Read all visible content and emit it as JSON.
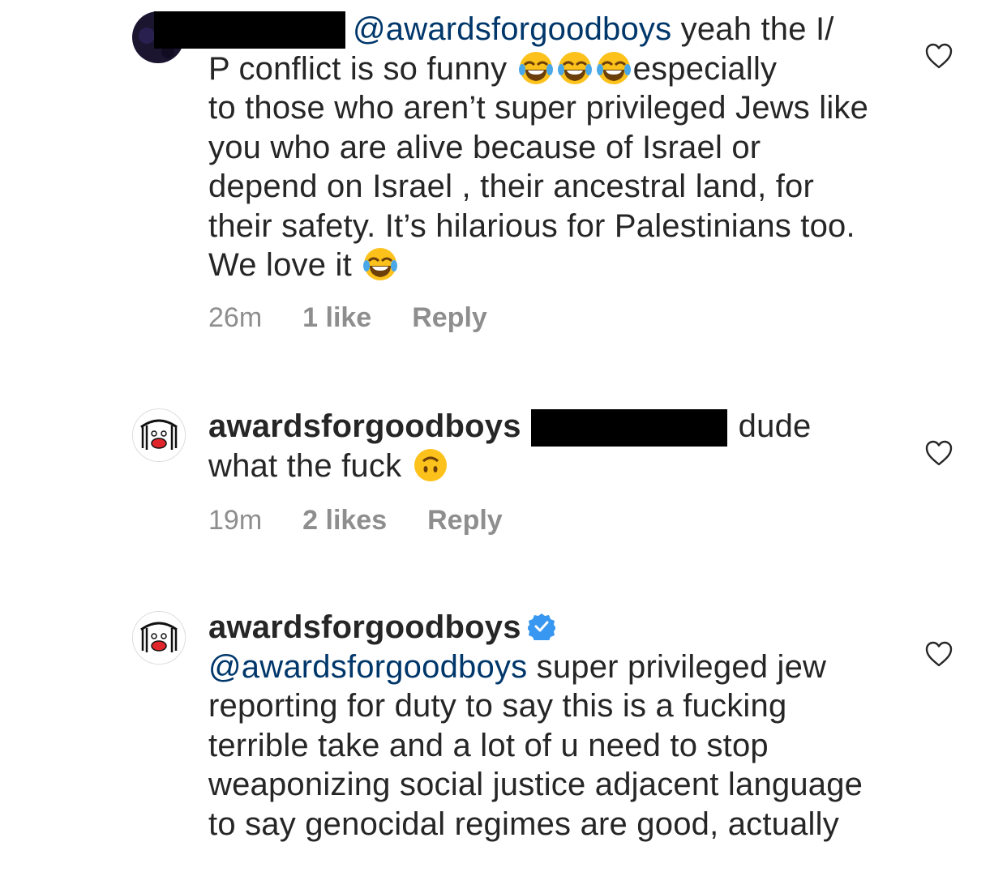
{
  "comments": [
    {
      "mention": "@awardsforgoodboys",
      "text_line1_rest": " yeah the I/",
      "text_line2_a": "P conflict is so funny ",
      "text_line2_b": "especially",
      "text_rest": "to those who aren’t super privileged Jews like you  who are alive because of Israel or depend on Israel , their ancestral land, for their safety. It’s hilarious for Palestinians too. We love it ",
      "time": "26m",
      "likes": "1 like",
      "reply": "Reply",
      "icons": [
        "avatar-redacted",
        "laughing-tears-emoji",
        "heart-outline-icon"
      ]
    },
    {
      "username": "awardsforgoodboys",
      "text_a": "dude",
      "text_b": "what the fuck ",
      "time": "19m",
      "likes": "2 likes",
      "reply": "Reply",
      "icons": [
        "avatar-drawing",
        "upside-down-face-emoji",
        "heart-outline-icon"
      ]
    },
    {
      "username": "awardsforgoodboys",
      "mention": "@awardsforgoodboys",
      "text": " super privileged jew reporting for duty to say this is a fucking terrible take and a lot of u need to stop weaponizing social justice adjacent language to say genocidal regimes are good, actually",
      "icons": [
        "avatar-drawing",
        "verified-badge-icon",
        "heart-outline-icon"
      ]
    }
  ],
  "colors": {
    "text": "#262626",
    "mention": "#00376b",
    "meta": "#8e8e8e",
    "verified": "#3897f0",
    "redaction": "#000000"
  }
}
